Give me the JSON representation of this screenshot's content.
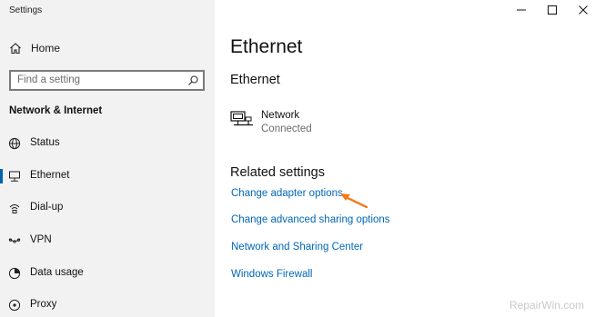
{
  "window": {
    "title": "Settings",
    "controls": [
      "minimize-icon",
      "maximize-icon",
      "close-icon"
    ]
  },
  "sidebar": {
    "home_label": "Home",
    "search_placeholder": "Find a setting",
    "section_title": "Network & Internet",
    "items": [
      {
        "label": "Status",
        "icon": "globe-icon",
        "active": false
      },
      {
        "label": "Ethernet",
        "icon": "ethernet-icon",
        "active": true
      },
      {
        "label": "Dial-up",
        "icon": "dialup-icon",
        "active": false
      },
      {
        "label": "VPN",
        "icon": "vpn-icon",
        "active": false
      },
      {
        "label": "Data usage",
        "icon": "data-usage-icon",
        "active": false
      },
      {
        "label": "Proxy",
        "icon": "proxy-icon",
        "active": false
      }
    ]
  },
  "main": {
    "page_title": "Ethernet",
    "section_title": "Ethernet",
    "network": {
      "name": "Network",
      "status": "Connected"
    },
    "related_title": "Related settings",
    "links": [
      "Change adapter options",
      "Change advanced sharing options",
      "Network and Sharing Center",
      "Windows Firewall"
    ]
  },
  "watermark": "RepairWin.com",
  "colors": {
    "accent": "#0063b1",
    "link": "#0067b8",
    "arrow": "#f07c1f",
    "sidebar_bg": "#f2f2f2"
  }
}
